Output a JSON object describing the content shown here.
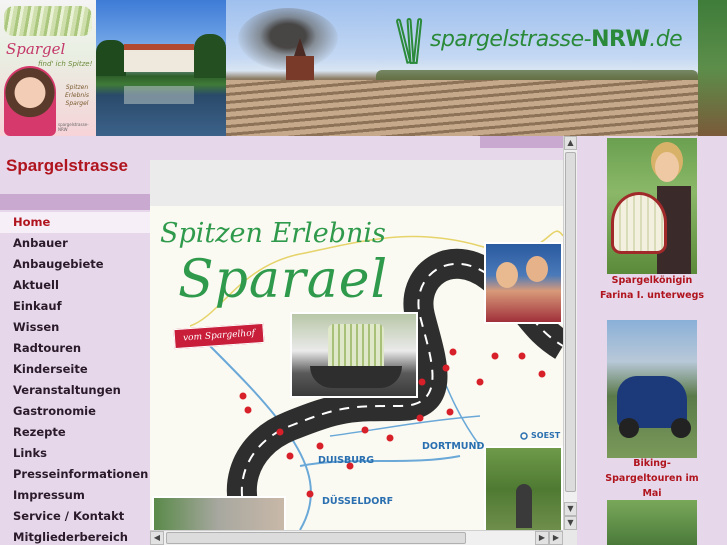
{
  "header": {
    "promo": {
      "title": "Spargel",
      "tagline": "find' ich Spitze!",
      "subtitle": "Spitzen Erlebnis Spargel",
      "logo_text": "spargelstrasse-NRW"
    },
    "brand_prefix": "spargelstrasse-",
    "brand_suffix": "NRW",
    "brand_tld": ".de"
  },
  "site_title": "Spargelstrasse",
  "nav": {
    "items": [
      {
        "label": "Home",
        "active": true
      },
      {
        "label": "Anbauer"
      },
      {
        "label": "Anbaugebiete"
      },
      {
        "label": "Aktuell"
      },
      {
        "label": "Einkauf"
      },
      {
        "label": "Wissen"
      },
      {
        "label": "Radtouren"
      },
      {
        "label": "Kinderseite"
      },
      {
        "label": "Veranstaltungen"
      },
      {
        "label": "Gastronomie"
      },
      {
        "label": "Rezepte"
      },
      {
        "label": "Links"
      },
      {
        "label": "Presseinformationen"
      },
      {
        "label": "Impressum"
      },
      {
        "label": "Service / Kontakt"
      },
      {
        "label": "Mitgliederbereich"
      }
    ]
  },
  "main": {
    "map_title_line1": "Spitzen Erlebnis",
    "map_title_line2": "Sparael",
    "badge": "vom Spargelhof",
    "cities": [
      "DORTMUND",
      "DUISBURG",
      "DÜSSELDORF",
      "SOEST"
    ]
  },
  "sidebar": {
    "queen_caption": "Spargelkönigin Farina I. unterwegs",
    "biking_caption": "Biking-Spargeltouren im Mai"
  },
  "colors": {
    "accent_red": "#b0141e",
    "brand_green": "#2a8a3a",
    "background_lilac": "#e6d8ea",
    "bar_lilac": "#c9a9cf"
  }
}
